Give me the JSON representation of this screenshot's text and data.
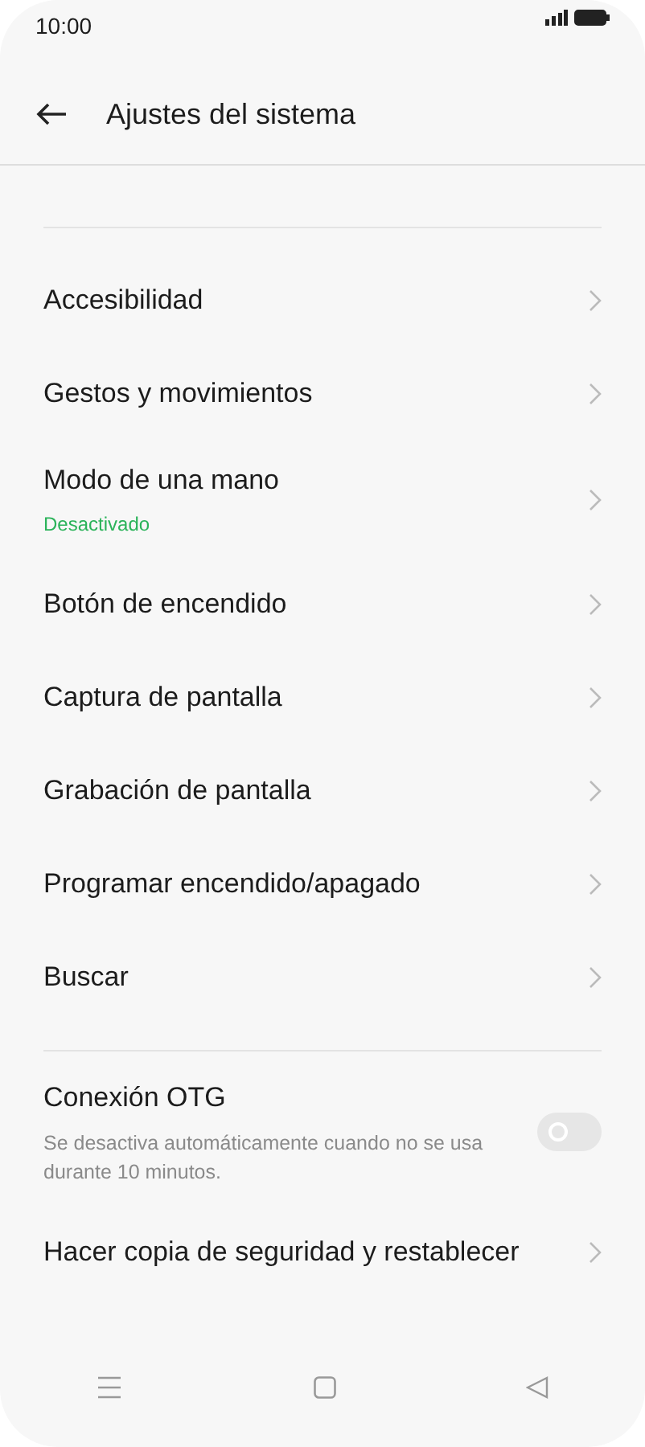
{
  "status_bar": {
    "time": "10:00"
  },
  "header": {
    "title": "Ajustes del sistema"
  },
  "sections": [
    {
      "items": [
        {
          "kind": "link",
          "label": "Accesibilidad"
        },
        {
          "kind": "link",
          "label": "Gestos y movimientos"
        },
        {
          "kind": "link",
          "label": "Modo de una mano",
          "status": "Desactivado"
        },
        {
          "kind": "link",
          "label": "Botón de encendido"
        },
        {
          "kind": "link",
          "label": "Captura de pantalla"
        },
        {
          "kind": "link",
          "label": "Grabación de pantalla"
        },
        {
          "kind": "link",
          "label": "Programar encendido/apagado"
        },
        {
          "kind": "link",
          "label": "Buscar"
        }
      ]
    },
    {
      "items": [
        {
          "kind": "toggle",
          "label": "Conexión OTG",
          "description": "Se desactiva automáticamente cuando no se usa durante 10 minutos.",
          "on": false
        },
        {
          "kind": "link",
          "label": "Hacer copia de seguridad y restablecer"
        }
      ]
    }
  ]
}
